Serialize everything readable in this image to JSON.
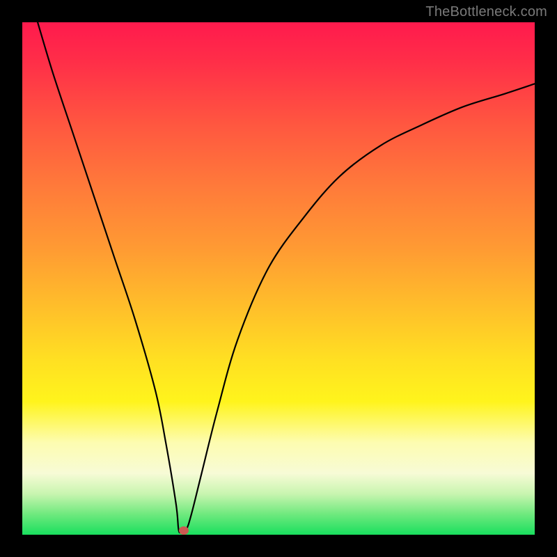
{
  "watermark": "TheBottleneck.com",
  "chart_data": {
    "type": "line",
    "title": "",
    "xlabel": "",
    "ylabel": "",
    "xlim": [
      0,
      100
    ],
    "ylim": [
      0,
      100
    ],
    "grid": false,
    "legend": false,
    "background": "vertical-gradient-red-to-green",
    "series": [
      {
        "name": "bottleneck-curve",
        "x": [
          3,
          6,
          10,
          14,
          18,
          22,
          26,
          28,
          30,
          30.5,
          31,
          32,
          33,
          35,
          38,
          42,
          48,
          55,
          62,
          70,
          78,
          86,
          94,
          100
        ],
        "y": [
          100,
          90,
          78,
          66,
          54,
          42,
          28,
          18,
          6,
          1,
          0.5,
          1,
          4,
          12,
          24,
          38,
          52,
          62,
          70,
          76,
          80,
          83.5,
          86,
          88
        ]
      }
    ],
    "marker": {
      "x": 31.5,
      "y": 0.8,
      "color": "#cc5a52"
    }
  },
  "colors": {
    "frame": "#000000",
    "curve": "#000000",
    "marker": "#cc5a52",
    "watermark": "#7a7a7a"
  }
}
